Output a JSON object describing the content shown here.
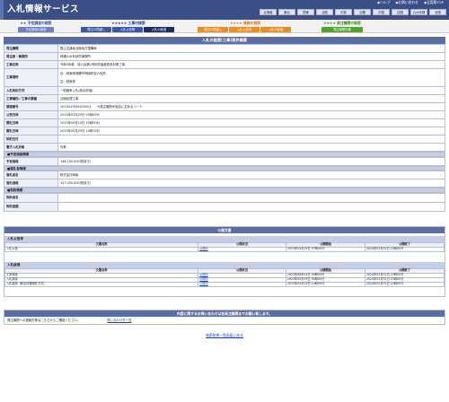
{
  "header": {
    "title": "入札情報サービス",
    "links": [
      "◆ヘルプ",
      "◆お問い合わせ",
      "◆全国版TOP"
    ],
    "regions": [
      "北海道",
      "東北",
      "関東",
      "北陸",
      "中部",
      "近畿",
      "中国",
      "四国",
      "九州沖縄",
      "全国"
    ]
  },
  "nav": {
    "groups": [
      {
        "title": "★★ 予定調達の検索",
        "color": "#3b4f86",
        "tabs": [
          {
            "label": "予定調達の検索",
            "color": "#6f82bd"
          }
        ]
      },
      {
        "title": "★★★★★ 工事の検索",
        "color": "#223b8a",
        "tabs": [
          {
            "label": "発注の見通し",
            "color": "#3d56a6"
          },
          {
            "label": "入札公告等",
            "color": "#3d56a6"
          },
          {
            "label": "入札の経過",
            "color": "#1b2c66"
          }
        ]
      },
      {
        "title": "★★★★ 業務の検索",
        "color": "#e07a10",
        "tabs": [
          {
            "label": "発注の見通し",
            "color": "#ea8d27"
          },
          {
            "label": "入札公告等",
            "color": "#ea8d27"
          },
          {
            "label": "入札の経過",
            "color": "#ea8d27"
          }
        ]
      },
      {
        "title": "★★★★ 発注機関の検索",
        "color": "#3a8a1c",
        "tabs": [
          {
            "label": "発注機関情報",
            "color": "#52a22e"
          }
        ]
      }
    ]
  },
  "detail": {
    "heading": "入札の経過(工事)案件概要",
    "rows": [
      {
        "label": "発注機関",
        "value": "国土交通省北陸地方整備局"
      },
      {
        "label": "発注部・事務所",
        "value": "神通川水系砂防事務所"
      },
      {
        "label": "工事名称",
        "value": "令和5年度　双六谷第2号砂防堰堤改良対策工事"
      },
      {
        "label": "工事場所",
        "value": "自：岐阜県飛騨市神岡町双六地先",
        "value2": "至：岐阜県"
      },
      {
        "label": "入札契約方式",
        "value": "一般競争入札(総合評価)"
      },
      {
        "label": "工事種別／工事の業種",
        "value": "法面処理工事"
      },
      {
        "label": "調達番号",
        "value": "2023047049010001　　※発注機関が独自に定めるコード"
      },
      {
        "label": "公告日時",
        "value": "2023年03月29日 00時00分"
      },
      {
        "label": "開札日時",
        "value": "2023年04月10日 10時00分"
      },
      {
        "label": "開札日時",
        "value": "2023年05月25日 14時15分"
      },
      {
        "label": "契約日付",
        "value": ""
      },
      {
        "label": "電子入札対象",
        "value": "対象"
      }
    ],
    "yotei_head": "■予定価格情報",
    "yotei_rows": [
      {
        "label": "予定価格",
        "value": "146,700,000(税抜き)"
      }
    ],
    "rakusatsu_head": "■落札者情報",
    "rakusatsu_rows": [
      {
        "label": "落札者名",
        "value": "株式会社岡組"
      },
      {
        "label": "落札価格",
        "value": "147,000,000(税抜き)"
      }
    ],
    "keiyaku_head": "■契約情報",
    "keiyaku_rows": [
      {
        "label": "契約者名",
        "value": ""
      },
      {
        "label": "契約金額",
        "value": ""
      }
    ]
  },
  "documents": {
    "heading": "公開文書",
    "kokoku": {
      "title": "入札公告等",
      "cols": [
        "文書名称",
        "公開状況",
        "公開開始",
        "公開終了"
      ],
      "rows": [
        {
          "name": "入札公告",
          "status": "公開中",
          "start": "2023年03月29日 07時00分",
          "end": "2024年03月31日 23時00分"
        }
      ]
    },
    "keika": {
      "title": "入札経過",
      "cols": [
        "文書名称",
        "公開状況",
        "公開開始",
        "公開終了"
      ],
      "rows": [
        {
          "name": "工事調書",
          "status": "公開中",
          "start": "2023年06月14日 00時00分",
          "end": "2024年03月31日 23時00分"
        },
        {
          "name": "入札調書",
          "status": "公開中",
          "start": "2023年05月29日 00時00分",
          "end": "2024年03月31日 23時00分"
        },
        {
          "name": "入札調書（総合評価落札方式）",
          "status": "公開中",
          "start": "2023年05月29日 14時00分",
          "end": "2024年03月31日 23時00分"
        }
      ]
    }
  },
  "contact": {
    "heading": "内容に関するお問い合わせは各発注機関までお願い致します。",
    "text": "発注機関への連絡先等はこちらからご確認ください。",
    "link": "問い合わせ先一覧"
  },
  "backlink": "検索結果一覧画面に戻る"
}
